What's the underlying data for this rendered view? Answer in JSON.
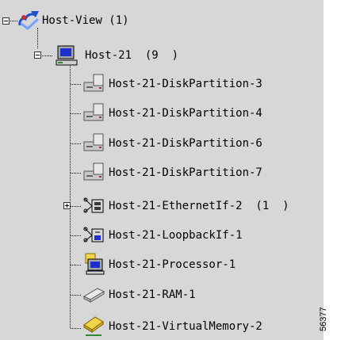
{
  "tree": {
    "root": {
      "label": "Host-View (1)",
      "icon": "network-view-icon",
      "expanded": true
    },
    "host": {
      "label": "Host-21  (9  )",
      "icon": "computer-monitor-icon",
      "expanded": true
    },
    "children": [
      {
        "label": "Host-21-DiskPartition-3",
        "icon": "disk-partition-icon",
        "expandable": false
      },
      {
        "label": "Host-21-DiskPartition-4",
        "icon": "disk-partition-icon",
        "expandable": false
      },
      {
        "label": "Host-21-DiskPartition-6",
        "icon": "disk-partition-icon",
        "expandable": false
      },
      {
        "label": "Host-21-DiskPartition-7",
        "icon": "disk-partition-icon",
        "expandable": false
      },
      {
        "label": "Host-21-EthernetIf-2  (1  )",
        "icon": "ethernet-interface-icon",
        "expandable": true
      },
      {
        "label": "Host-21-LoopbackIf-1",
        "icon": "loopback-interface-icon",
        "expandable": false
      },
      {
        "label": "Host-21-Processor-1",
        "icon": "processor-icon",
        "expandable": false
      },
      {
        "label": "Host-21-RAM-1",
        "icon": "ram-chip-icon",
        "expandable": false
      },
      {
        "label": "Host-21-VirtualMemory-2",
        "icon": "virtual-memory-icon",
        "expandable": false
      }
    ]
  },
  "figure_id": "56377"
}
